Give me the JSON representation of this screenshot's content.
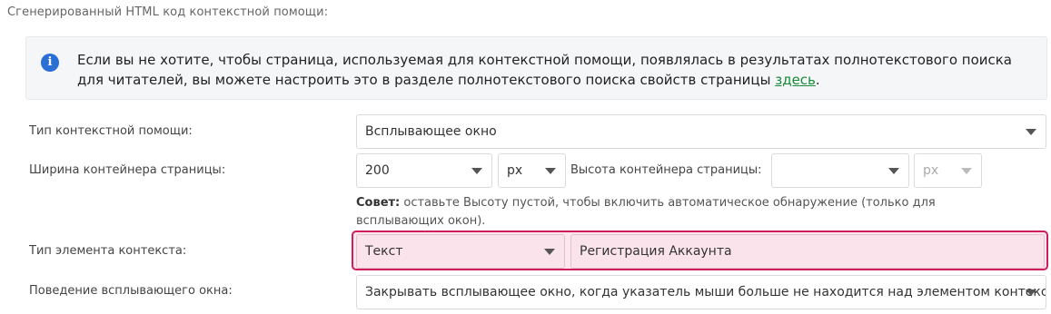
{
  "section_title": "Сгенерированный HTML код контекстной помощи:",
  "info": {
    "text": "Если вы не хотите, чтобы страница, используемая для контекстной помощи, появлялась в результатах полнотекстового поиска для читателей, вы можете настроить это в разделе полнотекстового поиска свойств страницы ",
    "link": "здесь",
    "end": ".",
    "icon": "info-circle-icon"
  },
  "help_type": {
    "label": "Тип контекстной помощи:",
    "value": "Всплывающее окно"
  },
  "container": {
    "width_label": "Ширина контейнера страницы:",
    "width_value": "200",
    "width_unit": "px",
    "height_label": "Высота контейнера страницы:",
    "height_value": "",
    "height_unit": "px"
  },
  "hint": {
    "bold": "Совет:",
    "text": " оставьте Высоту пустой, чтобы включить автоматическое обнаружение (только для всплывающих окон)."
  },
  "context_element": {
    "label": "Тип элемента контекста:",
    "type_value": "Текст",
    "text_value": "Регистрация Аккаунта"
  },
  "popup_behavior": {
    "label": "Поведение всплывающего окна:",
    "value": "Закрывать всплывающее окно, когда указатель мыши больше не находится над элементом контекста"
  },
  "colors": {
    "accent_link": "#1a8a3a",
    "highlight_border": "#d01e5c",
    "info_icon": "#2a6fd6"
  }
}
